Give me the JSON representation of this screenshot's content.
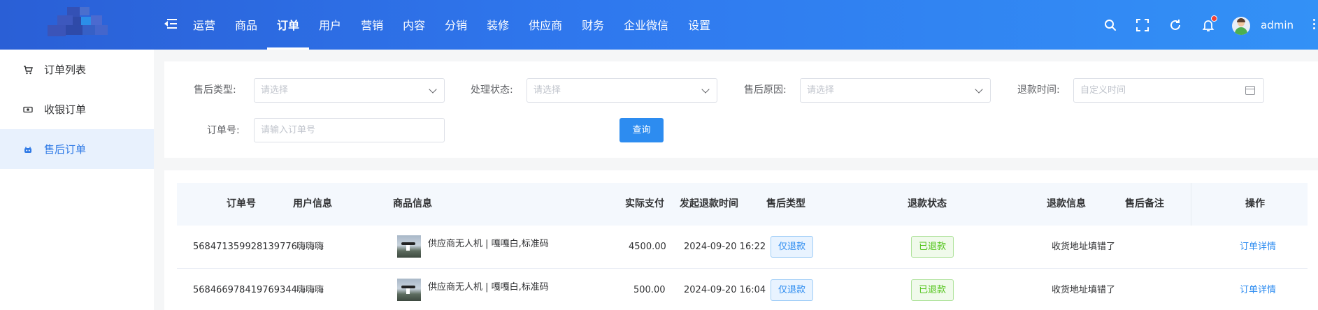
{
  "header": {
    "nav": [
      "运营",
      "商品",
      "订单",
      "用户",
      "营销",
      "内容",
      "分销",
      "装修",
      "供应商",
      "财务",
      "企业微信",
      "设置"
    ],
    "active_nav": "订单",
    "username": "admin",
    "icons": [
      "menu-toggle-icon",
      "search-icon",
      "fullscreen-icon",
      "refresh-icon",
      "bell-icon",
      "more-icon"
    ]
  },
  "sidebar": {
    "items": [
      {
        "label": "订单列表",
        "icon": "cart-icon"
      },
      {
        "label": "收银订单",
        "icon": "cashier-icon"
      },
      {
        "label": "售后订单",
        "icon": "after-sales-icon"
      }
    ],
    "active": "售后订单"
  },
  "filters": {
    "after_sale_type": {
      "label": "售后类型:",
      "placeholder": "请选择"
    },
    "process_status": {
      "label": "处理状态:",
      "placeholder": "请选择"
    },
    "after_sale_reason": {
      "label": "售后原因:",
      "placeholder": "请选择"
    },
    "refund_time": {
      "label": "退款时间:",
      "placeholder": "自定义时间"
    },
    "order_no": {
      "label": "订单号:",
      "placeholder": "请输入订单号"
    },
    "query_button": "查询"
  },
  "table": {
    "columns": [
      "订单号",
      "用户信息",
      "商品信息",
      "实际支付",
      "发起退款时间",
      "售后类型",
      "退款状态",
      "退款信息",
      "售后备注",
      "操作"
    ],
    "rows": [
      {
        "order_no": "568471359928139776",
        "user": "嗨嗨嗨",
        "product": "供应商无人机 | 嘎嘎白,标准码",
        "paid": "4500.00",
        "refund_time": "2024-09-20 16:22",
        "type": "仅退款",
        "status": "已退款",
        "refund_info": "收货地址填错了",
        "remark": "",
        "action": "订单详情"
      },
      {
        "order_no": "568466978419769344",
        "user": "嗨嗨嗨",
        "product": "供应商无人机 | 嘎嘎白,标准码",
        "paid": "500.00",
        "refund_time": "2024-09-20 16:04",
        "type": "仅退款",
        "status": "已退款",
        "refund_info": "收货地址填错了",
        "remark": "",
        "action": "订单详情"
      }
    ]
  },
  "colors": {
    "primary": "#2d8cf0",
    "header_start": "#2a5fd6",
    "header_end": "#3391f6",
    "success": "#52c41a",
    "sidebar_active_bg": "#e8f1fd"
  }
}
